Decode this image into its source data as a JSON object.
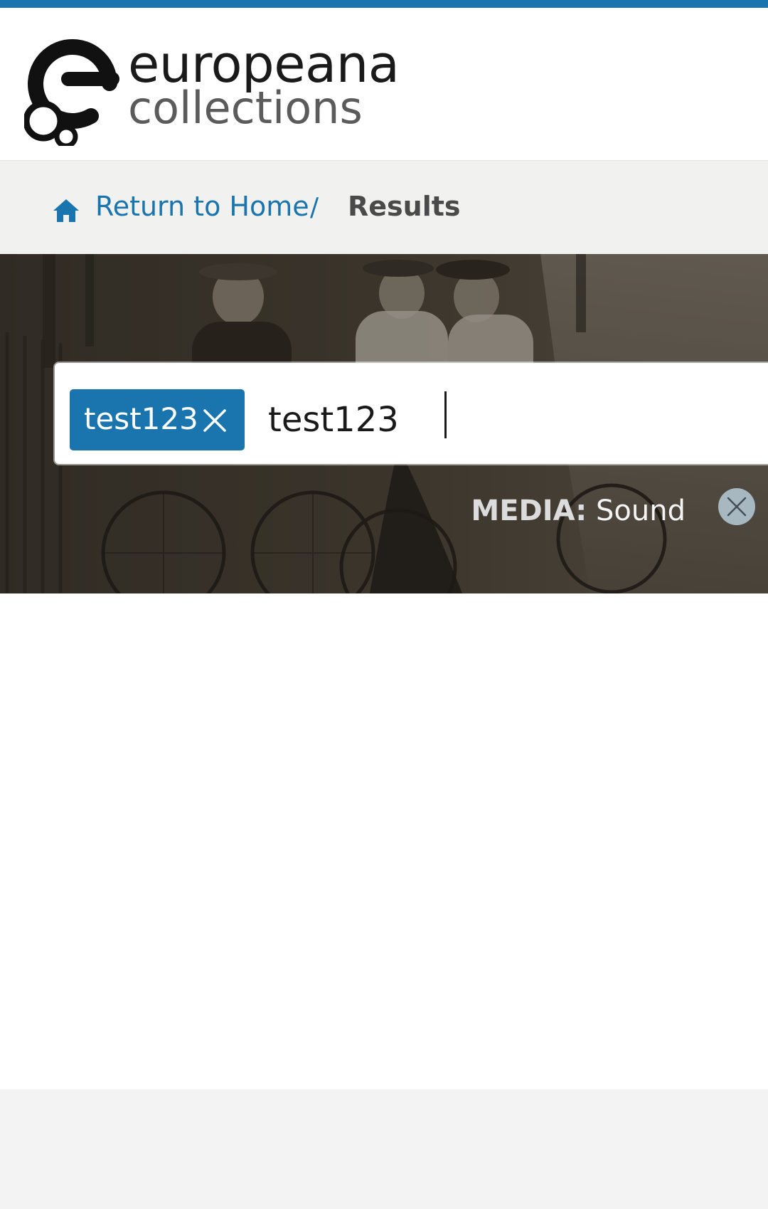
{
  "brand": {
    "name": "europeana",
    "subtitle": "collections",
    "accent_color": "#1a74ad"
  },
  "breadcrumb": {
    "home_icon": "home-icon",
    "home_label": "Return to Home",
    "separator": "/",
    "current": "Results"
  },
  "search": {
    "chip_label": "test123",
    "chip_remove_icon": "close-icon",
    "input_value": "test123"
  },
  "filters": [
    {
      "key": "MEDIA:",
      "value": "Sound",
      "remove_icon": "close-circle-icon"
    }
  ]
}
